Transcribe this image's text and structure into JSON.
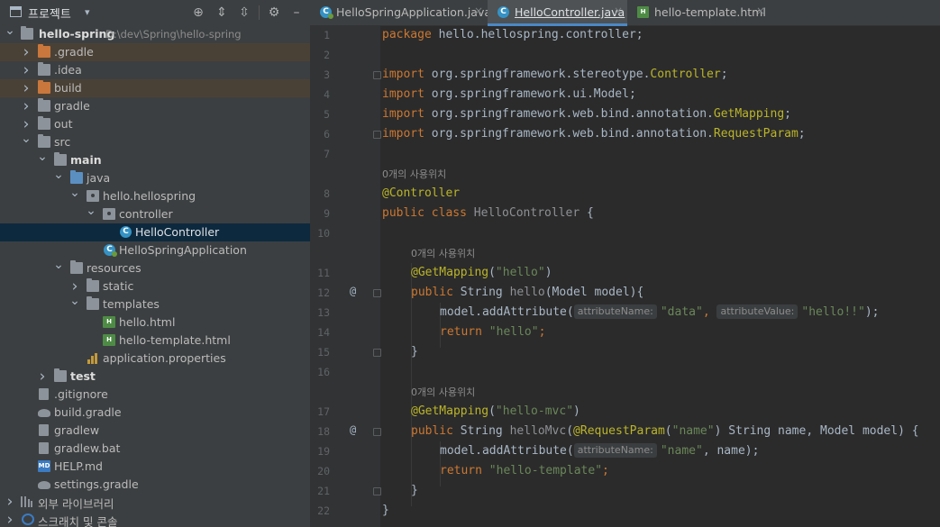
{
  "project_panel": {
    "title": "프로젝트",
    "header_icons": [
      "locate-icon",
      "expand-all-icon",
      "collapse-all-icon",
      "settings-icon",
      "hide-icon"
    ]
  },
  "tree": [
    {
      "label": "hello-spring",
      "path": "D:\\dev\\Spring\\hello-spring",
      "icon": "module-folder-icon",
      "expanded": true,
      "bold": true
    },
    {
      "label": ".gradle",
      "icon": "folder-icon",
      "expanded": false
    },
    {
      "label": ".idea",
      "icon": "folder-icon",
      "expanded": false
    },
    {
      "label": "build",
      "icon": "folder-icon",
      "expanded": false
    },
    {
      "label": "gradle",
      "icon": "folder-icon",
      "expanded": false
    },
    {
      "label": "out",
      "icon": "folder-icon",
      "expanded": false
    },
    {
      "label": "src",
      "icon": "folder-icon",
      "expanded": true
    },
    {
      "label": "main",
      "icon": "source-root-icon",
      "expanded": true,
      "bold": true
    },
    {
      "label": "java",
      "icon": "java-source-icon",
      "expanded": true
    },
    {
      "label": "hello.hellospring",
      "icon": "package-icon",
      "expanded": true
    },
    {
      "label": "controller",
      "icon": "package-icon",
      "expanded": true
    },
    {
      "label": "HelloController",
      "icon": "class-icon",
      "selected": true
    },
    {
      "label": "HelloSpringApplication",
      "icon": "spring-class-icon"
    },
    {
      "label": "resources",
      "icon": "resources-icon",
      "expanded": true
    },
    {
      "label": "static",
      "icon": "folder-icon",
      "expanded": false
    },
    {
      "label": "templates",
      "icon": "folder-icon",
      "expanded": true
    },
    {
      "label": "hello.html",
      "icon": "html-file-icon"
    },
    {
      "label": "hello-template.html",
      "icon": "html-file-icon"
    },
    {
      "label": "application.properties",
      "icon": "properties-file-icon"
    },
    {
      "label": "test",
      "icon": "test-folder-icon",
      "expanded": false,
      "bold": true
    },
    {
      "label": ".gitignore",
      "icon": "gitignore-icon"
    },
    {
      "label": "build.gradle",
      "icon": "gradle-icon"
    },
    {
      "label": "gradlew",
      "icon": "file-icon"
    },
    {
      "label": "gradlew.bat",
      "icon": "file-icon"
    },
    {
      "label": "HELP.md",
      "icon": "markdown-icon"
    },
    {
      "label": "settings.gradle",
      "icon": "gradle-icon"
    },
    {
      "label": "외부 라이브러리",
      "icon": "library-icon",
      "expanded": false
    },
    {
      "label": "스크래치 및 콘솔",
      "icon": "scratch-icon",
      "expanded": false
    }
  ],
  "tabs": [
    {
      "label": "HelloSpringApplication.java",
      "icon": "spring-class-icon",
      "active": false,
      "close": "×"
    },
    {
      "label": "HelloController.java",
      "icon": "class-icon",
      "active": true,
      "close": "×"
    },
    {
      "label": "hello-template.html",
      "icon": "html-file-icon",
      "active": false,
      "close": "×"
    }
  ],
  "usage_hint": "0개의 사용위치",
  "code_lines": [
    {
      "num": "1",
      "text": "package hello.hellospring.controller;"
    },
    {
      "num": "2",
      "text": ""
    },
    {
      "num": "3",
      "text": "import org.springframework.stereotype.Controller;"
    },
    {
      "num": "4",
      "text": "import org.springframework.ui.Model;"
    },
    {
      "num": "5",
      "text": "import org.springframework.web.bind.annotation.GetMapping;"
    },
    {
      "num": "6",
      "text": "import org.springframework.web.bind.annotation.RequestParam;"
    },
    {
      "num": "7",
      "text": ""
    },
    {
      "num": "8",
      "text": "@Controller"
    },
    {
      "num": "9",
      "text": "public class HelloController {"
    },
    {
      "num": "10",
      "text": ""
    },
    {
      "num": "11",
      "text": "@GetMapping(\"hello\")"
    },
    {
      "num": "12",
      "text": "public String hello(Model model){"
    },
    {
      "num": "13",
      "text": "model.addAttribute( attributeName: \"data\",  attributeValue: \"hello!!\");"
    },
    {
      "num": "14",
      "text": "return \"hello\";"
    },
    {
      "num": "15",
      "text": "}"
    },
    {
      "num": "16",
      "text": ""
    },
    {
      "num": "17",
      "text": "@GetMapping(\"hello-mvc\")"
    },
    {
      "num": "18",
      "text": "public String helloMvc(@RequestParam(\"name\") String name, Model model) {"
    },
    {
      "num": "19",
      "text": "model.addAttribute( attributeName: \"name\", name);"
    },
    {
      "num": "20",
      "text": "return \"hello-template\";"
    },
    {
      "num": "21",
      "text": "}"
    },
    {
      "num": "22",
      "text": "}"
    }
  ],
  "gutter_markers": {
    "12": "@",
    "18": "@"
  },
  "tokens": {
    "l1_kw": "package",
    "l1_rest": " hello.hellospring.controller;",
    "imp": "import",
    "l3_pkg": " org.springframework.stereotype.",
    "l3_cls": "Controller",
    "semi": ";",
    "l4_rest": " org.springframework.ui.Model;",
    "l5_pkg": " org.springframework.web.bind.annotation.",
    "l5_cls": "GetMapping",
    "l6_pkg": " org.springframework.web.bind.annotation.",
    "l6_cls": "RequestParam",
    "l8_an": "@Controller",
    "l9_kw": "public class",
    "l9_cls": " HelloController",
    "l9_rest": " {",
    "l11_an": "@GetMapping",
    "l11_p1": "(",
    "l11_st": "\"hello\"",
    "l11_p2": ")",
    "l12_kw": "public",
    "l12_type": " String ",
    "l12_fn": "hello",
    "l12_rest": "(Model model){",
    "l13_call": "model.addAttribute(",
    "l13_h1": "attributeName:",
    "l13_s1": "\"data\"",
    "l13_c": ", ",
    "l13_h2": "attributeValue:",
    "l13_s2": "\"hello!!\"",
    "l13_end": ");",
    "ret": "return",
    "l14_st": " \"hello\"",
    "l14_end": ";",
    "brace": "}",
    "l17_an": "@GetMapping",
    "l17_p1": "(",
    "l17_st": "\"hello-mvc\"",
    "l17_p2": ")",
    "l18_kw": "public",
    "l18_type": " String ",
    "l18_fn": "helloMvc",
    "l18_p": "(",
    "l18_an": "@RequestParam",
    "l18_p2": "(",
    "l18_st": "\"name\"",
    "l18_rest": ") String name, Model model) {",
    "l19_call": "model.addAttribute(",
    "l19_h1": "attributeName:",
    "l19_s1": "\"name\"",
    "l19_end": ", name);",
    "l20_st": " \"hello-template\"",
    "l20_end": ";"
  }
}
